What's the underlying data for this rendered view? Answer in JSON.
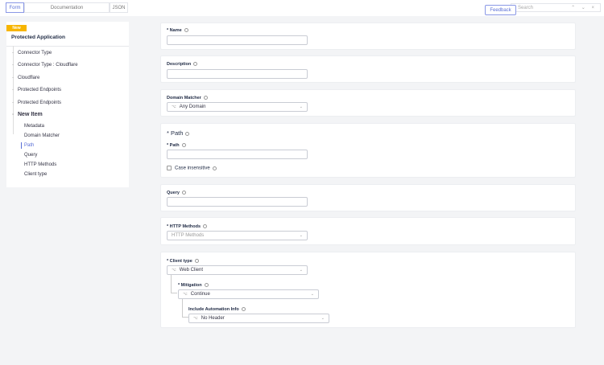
{
  "tabs": [
    {
      "label": "Form"
    },
    {
      "label": "Documentation"
    },
    {
      "label": "JSON"
    }
  ],
  "feedback": "Feedback",
  "search": {
    "placeholder": "Search",
    "arrows": "⌃ ⌄ ×"
  },
  "sidebar": {
    "badge": "New",
    "title": "Protected Application",
    "items": [
      {
        "label": "Connector Type"
      },
      {
        "label": "Connector Type : Cloudflare"
      },
      {
        "label": "Cloudflare"
      },
      {
        "label": "Protected Endpoints"
      },
      {
        "label": "Protected Endpoints"
      }
    ],
    "new_item": "New Item",
    "sub_items": [
      {
        "label": "Metadata"
      },
      {
        "label": "Domain Matcher"
      },
      {
        "label": "Path"
      },
      {
        "label": "Query"
      },
      {
        "label": "HTTP Methods"
      },
      {
        "label": "Client type"
      }
    ]
  },
  "form": {
    "name_label": "* Name",
    "description_label": "Description",
    "domain_matcher_label": "Domain Matcher",
    "domain_matcher_value": "Any Domain",
    "path_section": "* Path",
    "path_label": "* Path",
    "case_insensitive": "Case insensitive",
    "query_label": "Query",
    "http_methods_label": "* HTTP Methods",
    "http_methods_placeholder": "HTTP Methods",
    "client_type_label": "* Client type",
    "client_type_value": "Web Client",
    "mitigation_label": "* Mitigation",
    "mitigation_value": "Continue",
    "automation_label": "Include Automation Info",
    "automation_value": "No Header"
  }
}
